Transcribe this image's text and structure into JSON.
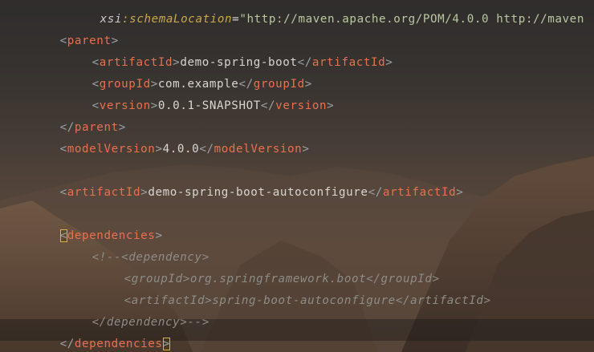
{
  "theme": {
    "bracket_color": "#9aa0a6",
    "tag_color": "#e8704f",
    "text_color": "#d8d6d0",
    "comment_color": "#8e8c86",
    "attr_color": "#c9a84b",
    "match_outline": "#d9b43b"
  },
  "editor": {
    "line0": {
      "ns": "xsi",
      "colon": ":",
      "attr": "schemaLocation",
      "eq": "=",
      "value": "\"http://maven.apache.org/POM/4.0.0 http://maven"
    },
    "parent_open": "parent",
    "parent_artifact_tag": "artifactId",
    "parent_artifact_value": "demo-spring-boot",
    "parent_group_tag": "groupId",
    "parent_group_value": "com.example",
    "parent_version_tag": "version",
    "parent_version_value": "0.0.1-SNAPSHOT",
    "parent_close": "parent",
    "model_tag": "modelVersion",
    "model_value": "4.0.0",
    "artifact_tag": "artifactId",
    "artifact_value": "demo-spring-boot-autoconfigure",
    "deps_tag": "dependencies",
    "comment_line1": "<!--<dependency>",
    "comment_line2": "<groupId>org.springframework.boot</groupId>",
    "comment_line3": "<artifactId>spring-boot-autoconfigure</artifactId>",
    "comment_line4": "</dependency>-->",
    "lt": "<",
    "gt": ">",
    "lt_slash": "</"
  }
}
